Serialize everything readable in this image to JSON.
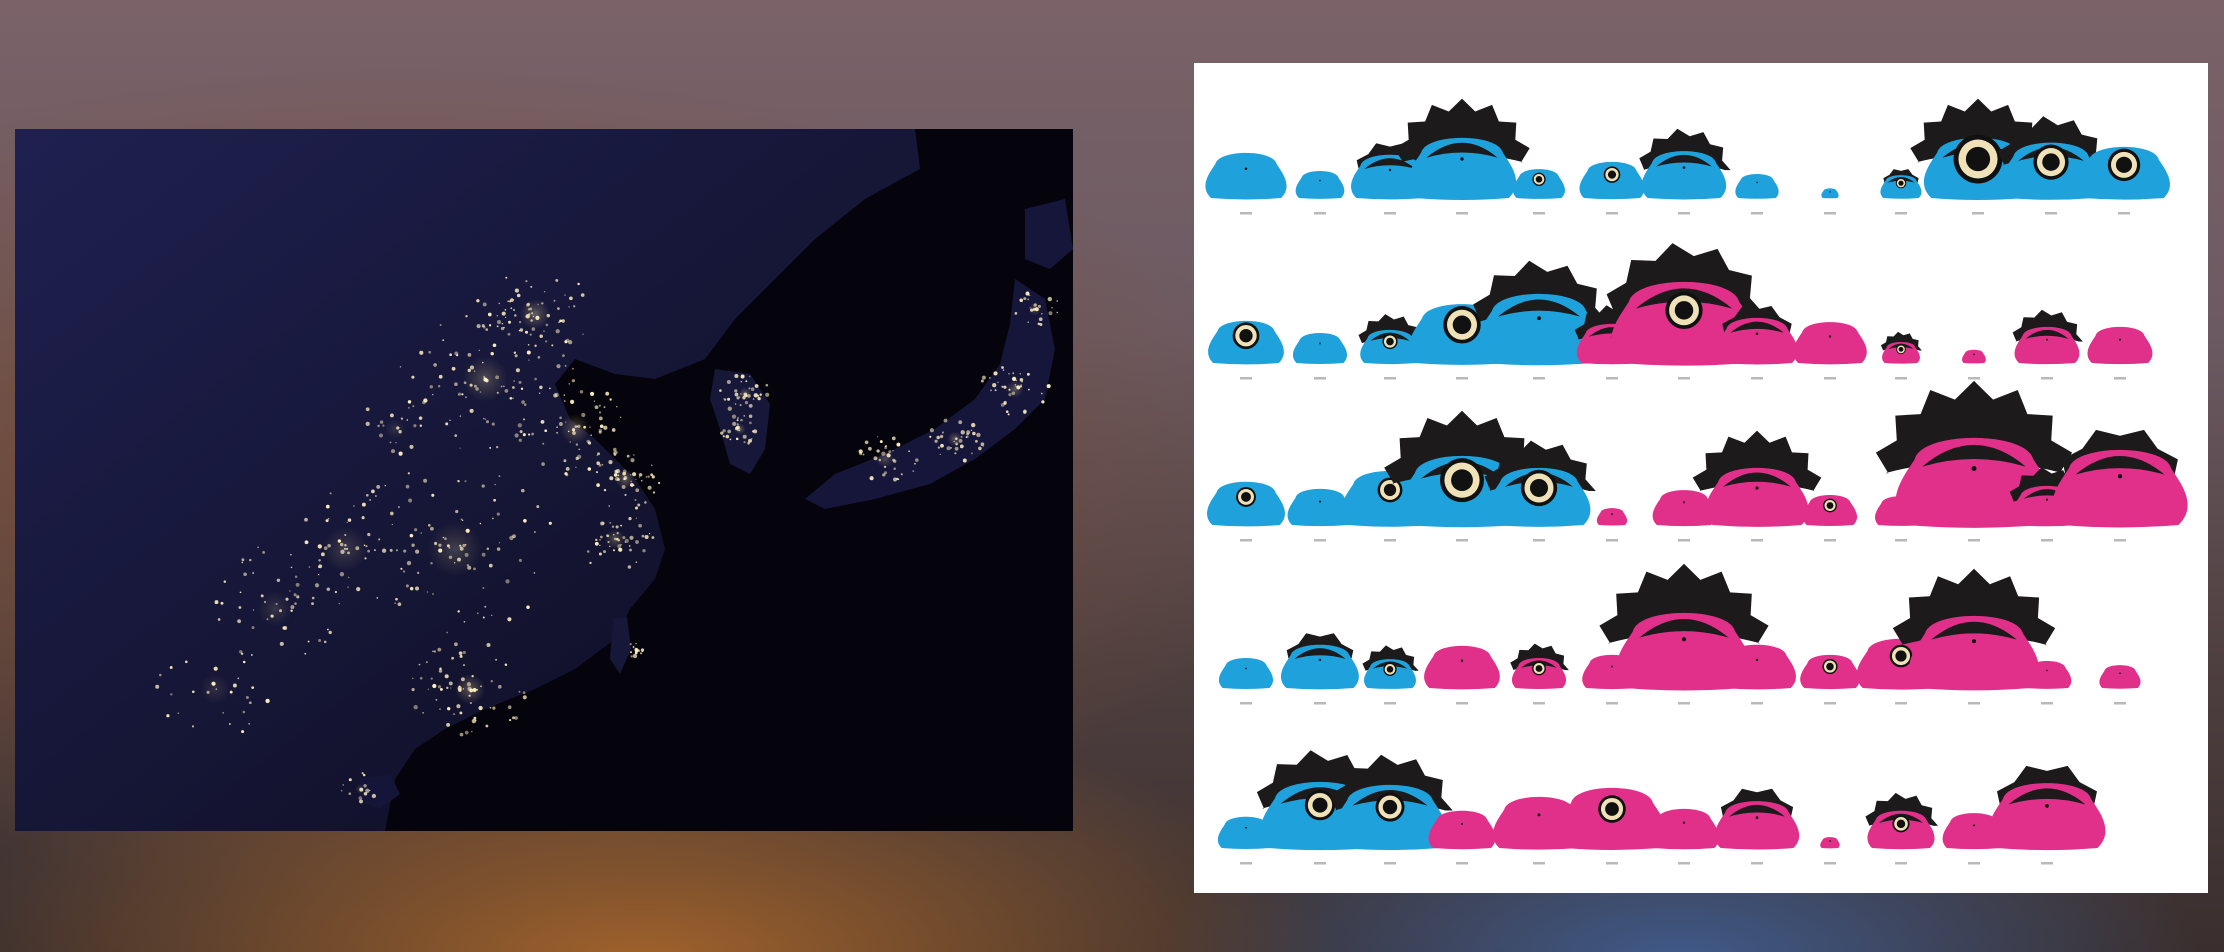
{
  "scene": {
    "description_colors": {
      "background_warm": "#a0622b",
      "background_cool": "#3f5a8a",
      "map_ocean": "#05040c",
      "map_land": "#151534",
      "city_lights": "#fff1c2",
      "blue_character": "#1fa2dc",
      "pink_character": "#e0308a",
      "hair": "#1c1a1a",
      "panel_white": "#ffffff"
    }
  },
  "left_image": {
    "type": "night-lights-satellite-map",
    "icon": "east-asia-night-map-icon"
  },
  "right_image": {
    "type": "character-grid-infographic",
    "icon": "penguin-character-grid-icon",
    "rows": [
      [
        {
          "c": "blue",
          "s": 0.75,
          "hair": 0,
          "eye": 0
        },
        {
          "c": "blue",
          "s": 0.45,
          "hair": 0,
          "eye": 0
        },
        {
          "c": "blue",
          "s": 0.72,
          "hair": 1,
          "eye": 0
        },
        {
          "c": "blue",
          "s": 1.0,
          "hair": 3,
          "eye": 0
        },
        {
          "c": "blue",
          "s": 0.48,
          "hair": 0,
          "eye": 1
        },
        {
          "c": "blue",
          "s": 0.6,
          "hair": 0,
          "eye": 1
        },
        {
          "c": "blue",
          "s": 0.78,
          "hair": 2,
          "eye": 0
        },
        {
          "c": "blue",
          "s": 0.4,
          "hair": 0,
          "eye": 0
        },
        {
          "c": "blue",
          "s": 0.16,
          "hair": 0,
          "eye": 0
        },
        {
          "c": "blue",
          "s": 0.38,
          "hair": 1,
          "eye": 1
        },
        {
          "c": "blue",
          "s": 1.0,
          "hair": 3,
          "eye": 3
        },
        {
          "c": "blue",
          "s": 0.92,
          "hair": 2,
          "eye": 2
        },
        {
          "c": "blue",
          "s": 0.85,
          "hair": 0,
          "eye": 2
        }
      ],
      [
        {
          "c": "blue",
          "s": 0.7,
          "hair": 0,
          "eye": 2
        },
        {
          "c": "blue",
          "s": 0.5,
          "hair": 0,
          "eye": 0
        },
        {
          "c": "blue",
          "s": 0.55,
          "hair": 2,
          "eye": 1
        },
        {
          "c": "blue",
          "s": 0.98,
          "hair": 0,
          "eye": 2
        },
        {
          "c": "blue",
          "s": 1.15,
          "hair": 2,
          "eye": 0
        },
        {
          "c": "pink",
          "s": 0.65,
          "hair": 2,
          "eye": 0
        },
        {
          "c": "pink",
          "s": 1.35,
          "hair": 2,
          "eye": 1
        },
        {
          "c": "pink",
          "s": 0.75,
          "hair": 1,
          "eye": 0
        },
        {
          "c": "pink",
          "s": 0.68,
          "hair": 0,
          "eye": 0
        },
        {
          "c": "pink",
          "s": 0.35,
          "hair": 2,
          "eye": 1
        },
        {
          "c": "pink",
          "s": 0.22,
          "hair": 0,
          "eye": 0
        },
        {
          "c": "pink",
          "s": 0.6,
          "hair": 2,
          "eye": 0
        },
        {
          "c": "pink",
          "s": 0.6,
          "hair": 0,
          "eye": 0
        }
      ],
      [
        {
          "c": "blue",
          "s": 0.72,
          "hair": 0,
          "eye": 1
        },
        {
          "c": "blue",
          "s": 0.6,
          "hair": 0,
          "eye": 0
        },
        {
          "c": "blue",
          "s": 0.9,
          "hair": 0,
          "eye": 1
        },
        {
          "c": "blue",
          "s": 1.15,
          "hair": 3,
          "eye": 2
        },
        {
          "c": "blue",
          "s": 0.95,
          "hair": 2,
          "eye": 2
        },
        {
          "c": "pink",
          "s": 0.28,
          "hair": 0,
          "eye": 0
        },
        {
          "c": "pink",
          "s": 0.58,
          "hair": 0,
          "eye": 0
        },
        {
          "c": "pink",
          "s": 0.95,
          "hair": 3,
          "eye": 0
        },
        {
          "c": "pink",
          "s": 0.5,
          "hair": 0,
          "eye": 1
        },
        {
          "c": "pink",
          "s": 0.48,
          "hair": 0,
          "eye": 0
        },
        {
          "c": "pink",
          "s": 1.45,
          "hair": 3,
          "eye": 0
        },
        {
          "c": "pink",
          "s": 0.65,
          "hair": 2,
          "eye": 0
        },
        {
          "c": "pink",
          "s": 1.25,
          "hair": 1,
          "eye": 0
        }
      ],
      [
        {
          "c": "blue",
          "s": 0.5,
          "hair": 0,
          "eye": 0
        },
        {
          "c": "blue",
          "s": 0.72,
          "hair": 1,
          "eye": 0
        },
        {
          "c": "blue",
          "s": 0.48,
          "hair": 2,
          "eye": 1
        },
        {
          "c": "pink",
          "s": 0.7,
          "hair": 0,
          "eye": 0
        },
        {
          "c": "pink",
          "s": 0.5,
          "hair": 2,
          "eye": 1
        },
        {
          "c": "pink",
          "s": 0.55,
          "hair": 0,
          "eye": 0
        },
        {
          "c": "pink",
          "s": 1.25,
          "hair": 3,
          "eye": 0
        },
        {
          "c": "pink",
          "s": 0.72,
          "hair": 0,
          "eye": 0
        },
        {
          "c": "pink",
          "s": 0.55,
          "hair": 0,
          "eye": 1
        },
        {
          "c": "pink",
          "s": 0.82,
          "hair": 0,
          "eye": 1
        },
        {
          "c": "pink",
          "s": 1.2,
          "hair": 3,
          "eye": 0
        },
        {
          "c": "pink",
          "s": 0.45,
          "hair": 0,
          "eye": 0
        },
        {
          "c": "pink",
          "s": 0.38,
          "hair": 0,
          "eye": 0
        }
      ],
      [
        {
          "c": "blue",
          "s": 0.52,
          "hair": 0,
          "eye": 0
        },
        {
          "c": "blue",
          "s": 1.1,
          "hair": 2,
          "eye": 1
        },
        {
          "c": "blue",
          "s": 1.05,
          "hair": 2,
          "eye": 1
        },
        {
          "c": "pink",
          "s": 0.62,
          "hair": 0,
          "eye": 0
        },
        {
          "c": "pink",
          "s": 0.85,
          "hair": 0,
          "eye": 0
        },
        {
          "c": "pink",
          "s": 1.0,
          "hair": 0,
          "eye": 1
        },
        {
          "c": "pink",
          "s": 0.65,
          "hair": 0,
          "eye": 0
        },
        {
          "c": "pink",
          "s": 0.78,
          "hair": 1,
          "eye": 0
        },
        {
          "c": "pink",
          "s": 0.18,
          "hair": 0,
          "eye": 0
        },
        {
          "c": "pink",
          "s": 0.62,
          "hair": 2,
          "eye": 1
        },
        {
          "c": "pink",
          "s": 0.58,
          "hair": 0,
          "eye": 0
        },
        {
          "c": "pink",
          "s": 1.08,
          "hair": 1,
          "eye": 0
        }
      ]
    ]
  }
}
